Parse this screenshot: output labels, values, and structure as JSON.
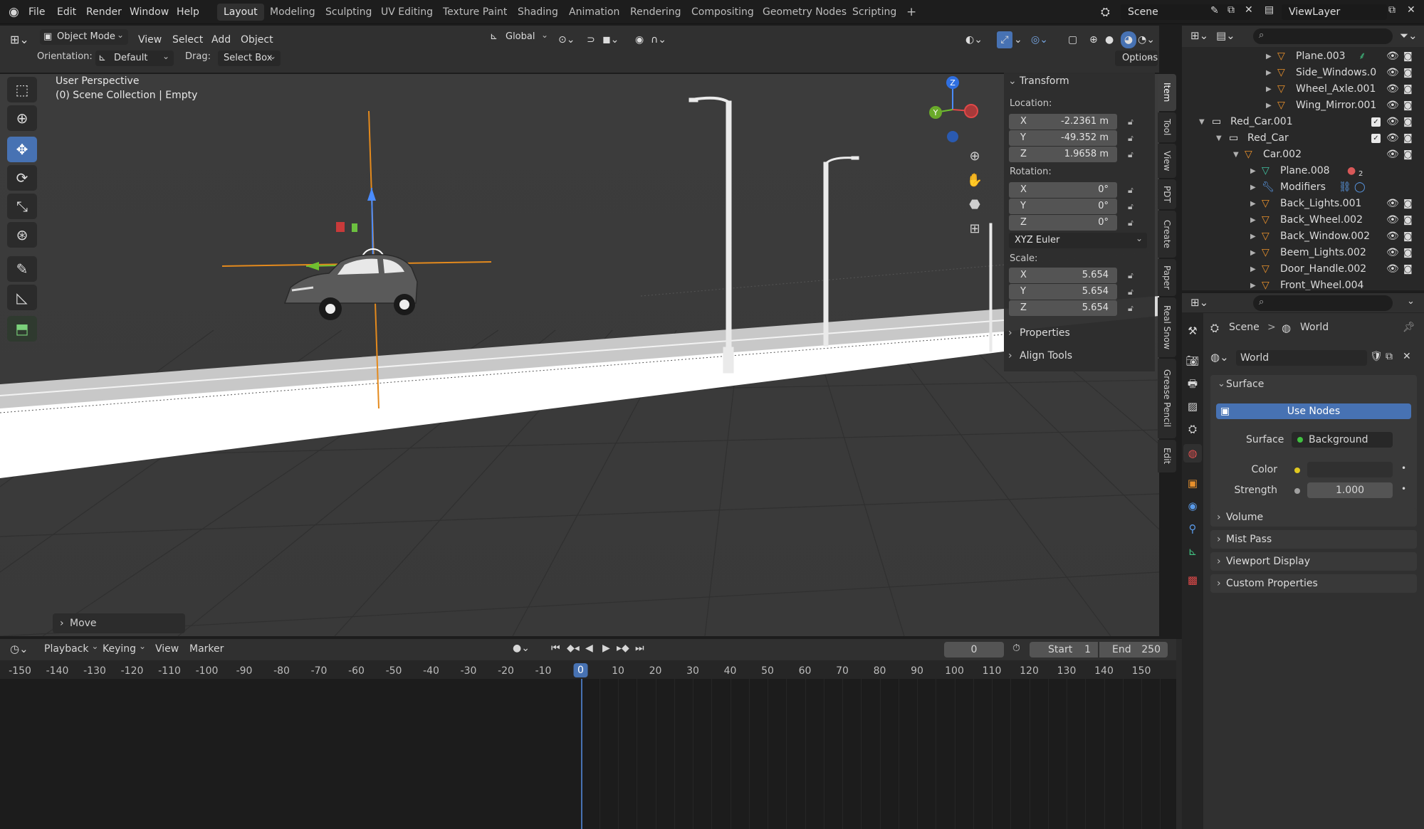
{
  "topbar": {
    "menus": [
      "File",
      "Edit",
      "Render",
      "Window",
      "Help"
    ],
    "workspaces": [
      "Layout",
      "Modeling",
      "Sculpting",
      "UV Editing",
      "Texture Paint",
      "Shading",
      "Animation",
      "Rendering",
      "Compositing",
      "Geometry Nodes",
      "Scripting"
    ],
    "active_workspace": "Layout",
    "add_workspace": "+",
    "scene": "Scene",
    "view_layer": "ViewLayer"
  },
  "viewport_header": {
    "mode": "Object Mode",
    "menus": [
      "View",
      "Select",
      "Add",
      "Object"
    ],
    "transform_orientation": "Global",
    "orientation_label": "Orientation:",
    "orientation_value": "Default",
    "drag_label": "Drag:",
    "drag_value": "Select Box",
    "options": "Options"
  },
  "viewport": {
    "perspective": "User Perspective",
    "collection_info": "(0) Scene Collection | Empty",
    "last_operator": "Move",
    "gizmo_axes": {
      "x": "X",
      "y": "Y",
      "z": "Z"
    }
  },
  "npanel": {
    "title": "Transform",
    "location_label": "Location:",
    "location": [
      {
        "axis": "X",
        "value": "-2.2361 m"
      },
      {
        "axis": "Y",
        "value": "-49.352 m"
      },
      {
        "axis": "Z",
        "value": "1.9658 m"
      }
    ],
    "rotation_label": "Rotation:",
    "rotation": [
      {
        "axis": "X",
        "value": "0°"
      },
      {
        "axis": "Y",
        "value": "0°"
      },
      {
        "axis": "Z",
        "value": "0°"
      }
    ],
    "rotation_mode": "XYZ Euler",
    "scale_label": "Scale:",
    "scale": [
      {
        "axis": "X",
        "value": "5.654"
      },
      {
        "axis": "Y",
        "value": "5.654"
      },
      {
        "axis": "Z",
        "value": "5.654"
      }
    ],
    "properties": "Properties",
    "align_tools": "Align Tools",
    "tabs": [
      "Item",
      "Tool",
      "View",
      "PDT",
      "Create",
      "Paper",
      "Real Snow",
      "Grease Pencil",
      "Edit"
    ]
  },
  "outliner": {
    "rows": [
      {
        "label": "Plane.003"
      },
      {
        "label": "Side_Windows.0"
      },
      {
        "label": "Wheel_Axle.001"
      },
      {
        "label": "Wing_Mirror.001"
      },
      {
        "label": "Red_Car.001"
      },
      {
        "label": "Red_Car"
      },
      {
        "label": "Car.002"
      },
      {
        "label": "Plane.008",
        "badge": "2"
      },
      {
        "label": "Modifiers"
      },
      {
        "label": "Back_Lights.001"
      },
      {
        "label": "Back_Wheel.002"
      },
      {
        "label": "Back_Window.002"
      },
      {
        "label": "Beem_Lights.002"
      },
      {
        "label": "Door_Handle.002"
      },
      {
        "label": "Front_Wheel.004"
      }
    ]
  },
  "properties": {
    "breadcrumb_scene": "Scene",
    "breadcrumb_sep": ">",
    "breadcrumb_world": "World",
    "world_name": "World",
    "surface_section": "Surface",
    "use_nodes": "Use Nodes",
    "surface_label": "Surface",
    "surface_value": "Background",
    "color_label": "Color",
    "strength_label": "Strength",
    "strength_value": "1.000",
    "sections": [
      "Volume",
      "Mist Pass",
      "Viewport Display",
      "Custom Properties"
    ]
  },
  "timeline": {
    "menus": [
      "Playback",
      "Keying",
      "View",
      "Marker"
    ],
    "current_frame": "0",
    "start_label": "Start",
    "start_value": "1",
    "end_label": "End",
    "end_value": "250",
    "ruler": [
      "-150",
      "-140",
      "-130",
      "-120",
      "-110",
      "-100",
      "-90",
      "-80",
      "-70",
      "-60",
      "-50",
      "-40",
      "-30",
      "-20",
      "-10",
      "0",
      "10",
      "20",
      "30",
      "40",
      "50",
      "60",
      "70",
      "80",
      "90",
      "100",
      "110",
      "120",
      "130",
      "140",
      "150"
    ]
  }
}
